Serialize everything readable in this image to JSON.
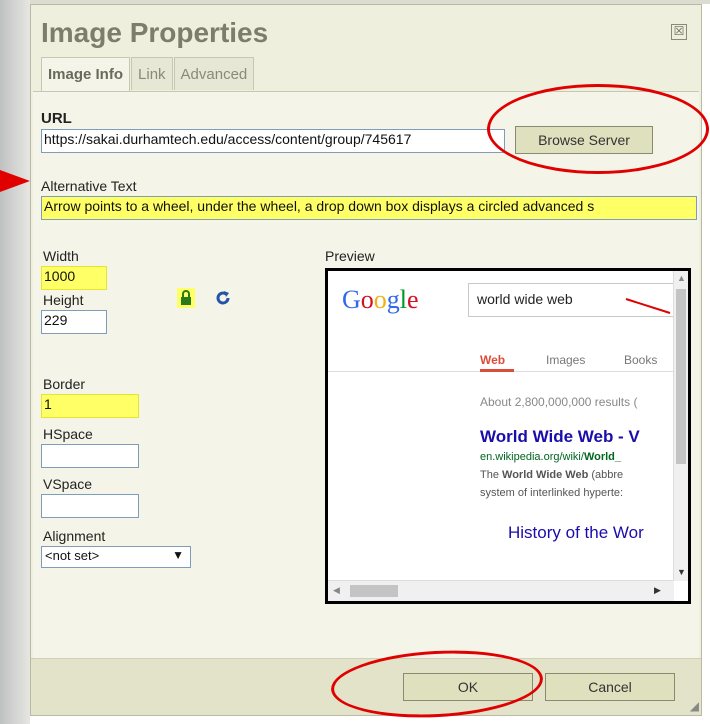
{
  "dialog": {
    "title": "Image Properties",
    "close_label": "☒",
    "tabs": [
      {
        "label": "Image Info",
        "active": true
      },
      {
        "label": "Link",
        "active": false
      },
      {
        "label": "Advanced",
        "active": false
      }
    ]
  },
  "image_info": {
    "url_label": "URL",
    "url_value": "https://sakai.durhamtech.edu/access/content/group/745617",
    "browse_label": "Browse Server",
    "alt_label": "Alternative Text",
    "alt_value": "Arrow points to a wheel, under the wheel, a drop down box displays a circled advanced s",
    "width_label": "Width",
    "width_value": "1000",
    "height_label": "Height",
    "height_value": "229",
    "border_label": "Border",
    "border_value": "1",
    "hspace_label": "HSpace",
    "hspace_value": "",
    "vspace_label": "VSpace",
    "vspace_value": "",
    "alignment_label": "Alignment",
    "alignment_value": "<not set>",
    "preview_label": "Preview"
  },
  "preview": {
    "logo_letters": [
      "G",
      "o",
      "o",
      "g",
      "l",
      "e"
    ],
    "logo_colors": [
      "#3369e8",
      "#d50f25",
      "#eeb211",
      "#3369e8",
      "#009925",
      "#d50f25"
    ],
    "search_text": "world wide web",
    "tabs": [
      "Web",
      "Images",
      "Books"
    ],
    "results_count": "About 2,800,000,000 results (",
    "result1_title": "World Wide Web - V",
    "result1_url_prefix": "en.wikipedia.org/wiki/",
    "result1_url_bold": "World_",
    "result1_snip1_prefix": "The ",
    "result1_snip1_bold": "World Wide Web",
    "result1_snip1_suffix": " (abbre",
    "result1_snip2": "system of interlinked hyperte:",
    "result2_title": "History of the Wor"
  },
  "footer": {
    "ok_label": "OK",
    "cancel_label": "Cancel"
  },
  "colors": {
    "highlight": "#ffff66",
    "annotation_red": "#e00000",
    "dialog_bg": "#efefde"
  }
}
